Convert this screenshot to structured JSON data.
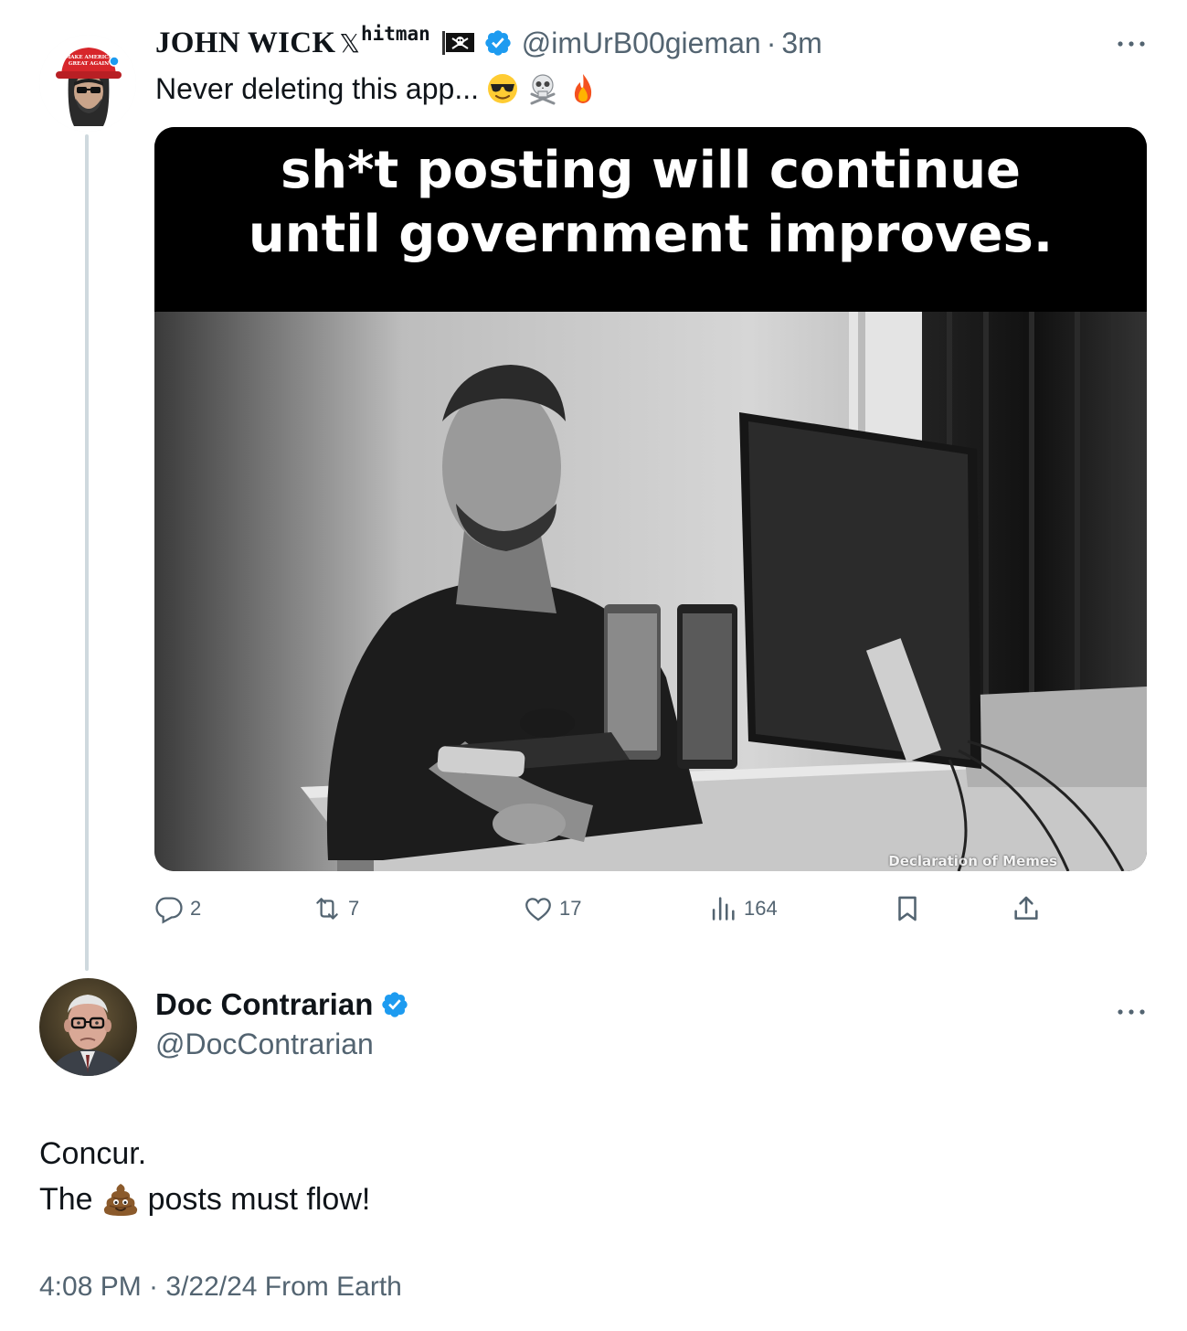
{
  "tweet": {
    "author_name": "JOHN WICK",
    "author_x_glyph": "𝕏",
    "author_name_suffix": "hitman",
    "author_handle": "@imUrB00gieman",
    "separator": "·",
    "time_ago": "3m",
    "text": "Never deleting this app...",
    "text_emojis": [
      "sunglasses-face",
      "skull-crossbones",
      "fire"
    ],
    "image": {
      "caption_line1": "sh*t posting will continue",
      "caption_line2": "until government improves.",
      "watermark": "Declaration of Memes"
    },
    "actions": {
      "replies": "2",
      "reposts": "7",
      "likes": "17",
      "views": "164"
    },
    "avatar_hat_text_line1": "MAKE AMERICA",
    "avatar_hat_text_line2": "GREAT AGAIN"
  },
  "reply": {
    "author_name": "Doc Contrarian",
    "author_handle": "@DocContrarian",
    "line1": "Concur.",
    "line2_before": "The",
    "line2_after": "posts must flow!",
    "meta": "4:08 PM · 3/22/24 From Earth"
  },
  "icons": {
    "verified": "verified-badge-icon",
    "more": "more-horizontal-icon",
    "reply": "reply-icon",
    "repost": "repost-icon",
    "like": "heart-icon",
    "views": "views-icon",
    "bookmark": "bookmark-icon",
    "share": "share-icon",
    "flag": "pirate-flag-icon",
    "poop": "pile-of-poo-icon"
  },
  "colors": {
    "text_primary": "#0f1419",
    "text_secondary": "#536471",
    "verified_blue": "#1d9bf0",
    "thread_line": "#cfd9de",
    "hat_red": "#d7262b"
  }
}
